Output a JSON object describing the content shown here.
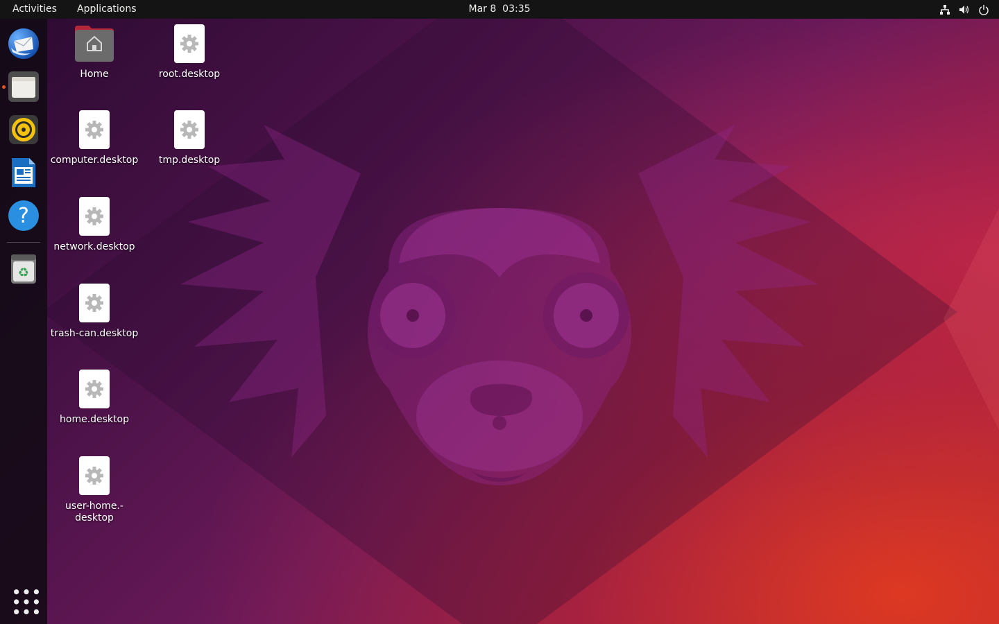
{
  "topbar": {
    "activities_label": "Activities",
    "applications_label": "Applications",
    "clock": "Mar 8  03:35",
    "tray_icons": [
      "network-icon",
      "volume-icon",
      "power-icon"
    ]
  },
  "dock": {
    "items": [
      {
        "name": "thunderbird",
        "icon": "thunderbird-mail-icon",
        "running": false
      },
      {
        "name": "files",
        "icon": "files-icon",
        "running": true
      },
      {
        "name": "rhythmbox",
        "icon": "rhythmbox-icon",
        "running": false
      },
      {
        "name": "libreoffice-writer",
        "icon": "libreoffice-writer-icon",
        "running": false
      },
      {
        "name": "help",
        "icon": "help-icon",
        "running": false
      },
      {
        "name": "trash",
        "icon": "trash-icon",
        "running": false
      }
    ],
    "show_apps_icon": "app-grid-icon"
  },
  "desktop": {
    "icons": [
      {
        "label": "Home",
        "icon": "home-folder-icon"
      },
      {
        "label": "root.desktop",
        "icon": "desktop-file-gear-icon"
      },
      {
        "label": "computer.desktop",
        "icon": "desktop-file-gear-icon"
      },
      {
        "label": "tmp.desktop",
        "icon": "desktop-file-gear-icon"
      },
      {
        "label": "network.desktop",
        "icon": "desktop-file-gear-icon"
      },
      {
        "label": "trash-can.desktop",
        "icon": "desktop-file-gear-icon"
      },
      {
        "label": "home.desktop",
        "icon": "desktop-file-gear-icon"
      },
      {
        "label": "user-home.-\ndesktop",
        "icon": "desktop-file-gear-icon"
      }
    ]
  },
  "colors": {
    "topbar_bg": "#141414",
    "accent": "#e95420",
    "wallpaper_start": "#2a0a30",
    "wallpaper_end": "#b42a32"
  }
}
